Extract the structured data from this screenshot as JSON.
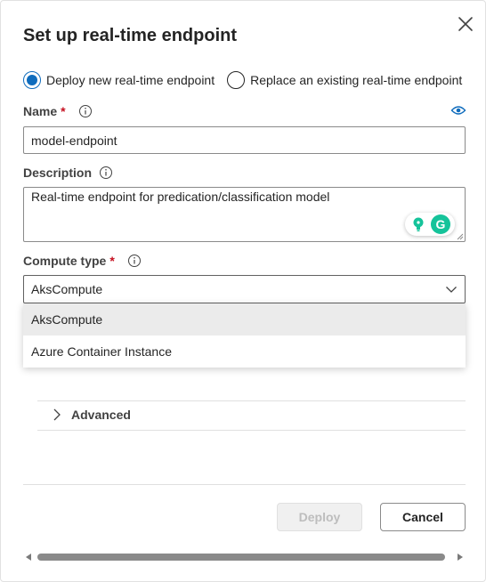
{
  "dialog": {
    "title": "Set up real-time endpoint",
    "close_icon": "close-icon"
  },
  "deploy_mode": {
    "options": [
      {
        "label": "Deploy new real-time endpoint",
        "checked": true
      },
      {
        "label": "Replace an existing real-time endpoint",
        "checked": false
      }
    ]
  },
  "name_field": {
    "label": "Name",
    "required_mark": "*",
    "value": "model-endpoint",
    "info_icon": "info-icon",
    "visibility_icon": "eye-icon"
  },
  "description_field": {
    "label": "Description",
    "value": "Real-time endpoint for predication/classification model",
    "info_icon": "info-icon"
  },
  "grammarly": {
    "logo_letter": "G",
    "bulb_icon": "lightbulb-icon"
  },
  "compute_type": {
    "label": "Compute type",
    "required_mark": "*",
    "selected": "AksCompute",
    "options": [
      "AksCompute",
      "Azure Container Instance"
    ]
  },
  "advanced": {
    "label": "Advanced",
    "expanded": false
  },
  "footer": {
    "deploy_label": "Deploy",
    "deploy_enabled": false,
    "cancel_label": "Cancel"
  },
  "colors": {
    "accent": "#0f6cbd",
    "required": "#c50f1f",
    "grammarly": "#15c39a"
  }
}
